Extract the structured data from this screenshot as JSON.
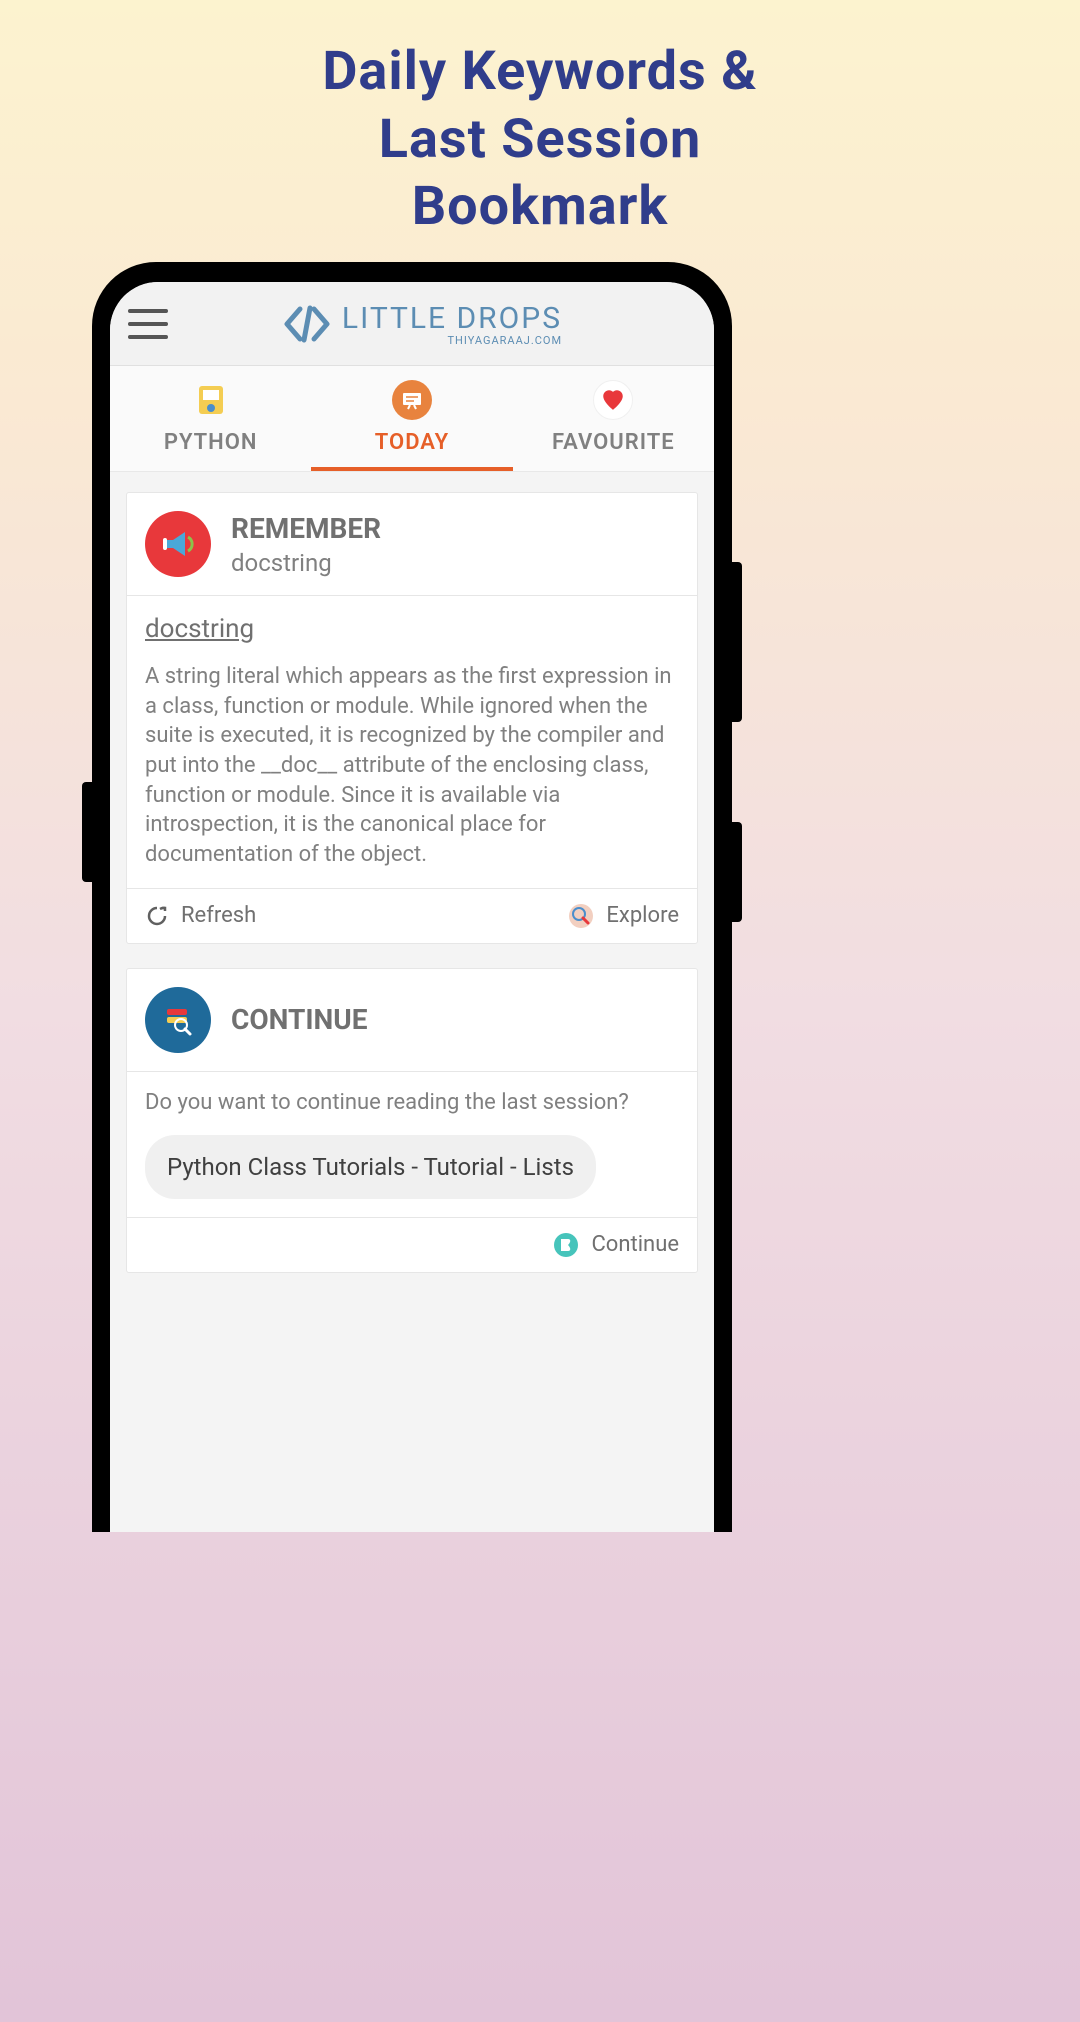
{
  "promo": {
    "line1": "Daily Keywords &",
    "line2": "Last Session",
    "line3": "Bookmark"
  },
  "header": {
    "brand_name": "LITTLE DROPS",
    "brand_sub": "THIYAGARAAJ.COM"
  },
  "tabs": [
    {
      "label": "PYTHON",
      "active": false,
      "icon": "python"
    },
    {
      "label": "TODAY",
      "active": true,
      "icon": "board"
    },
    {
      "label": "FAVOURITE",
      "active": false,
      "icon": "heart"
    }
  ],
  "remember": {
    "title": "REMEMBER",
    "subtitle": "docstring",
    "body_title": "docstring",
    "body_text": "A string literal which appears as the first expression in a class, function or module. While ignored when the suite is executed, it is recognized by the compiler and put into the __doc__ attribute of the enclosing class, function or module. Since it is available via introspection, it is the canonical place for documentation of the object.",
    "refresh_label": "Refresh",
    "explore_label": "Explore"
  },
  "continue": {
    "title": "CONTINUE",
    "prompt": "Do you want to continue reading the last session?",
    "session": "Python Class Tutorials - Tutorial - Lists",
    "continue_label": "Continue"
  }
}
